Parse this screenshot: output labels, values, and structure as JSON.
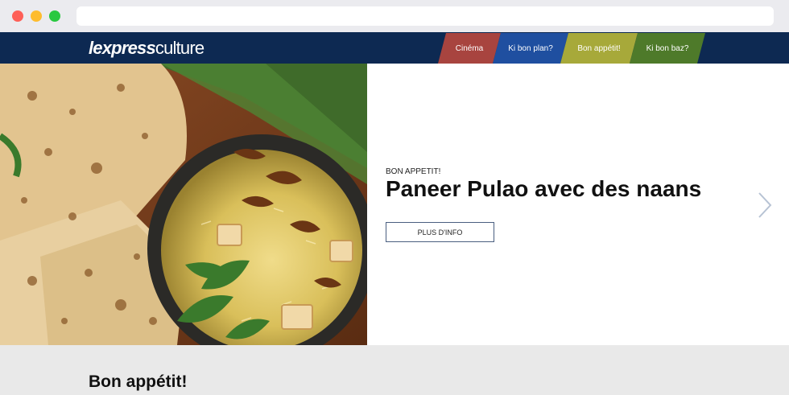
{
  "browser": {
    "url": ""
  },
  "header": {
    "logo_bold": "lexpress",
    "logo_light": "culture",
    "nav": [
      {
        "label": "Cinéma",
        "color": "#a8443f"
      },
      {
        "label": "Ki bon plan?",
        "color": "#1f4fa0"
      },
      {
        "label": "Bon appétit!",
        "color": "#a7a93a"
      },
      {
        "label": "Ki bon baz?",
        "color": "#4e7a2a"
      }
    ],
    "background": "#0d2952"
  },
  "hero": {
    "image_icon": "food-photo-icon",
    "kicker": "BON APPETIT!",
    "title": "Paneer Pulao avec des naans",
    "button_label": "PLUS D'INFO",
    "next_icon": "chevron-right-icon"
  },
  "section": {
    "title": "Bon appétit!"
  }
}
